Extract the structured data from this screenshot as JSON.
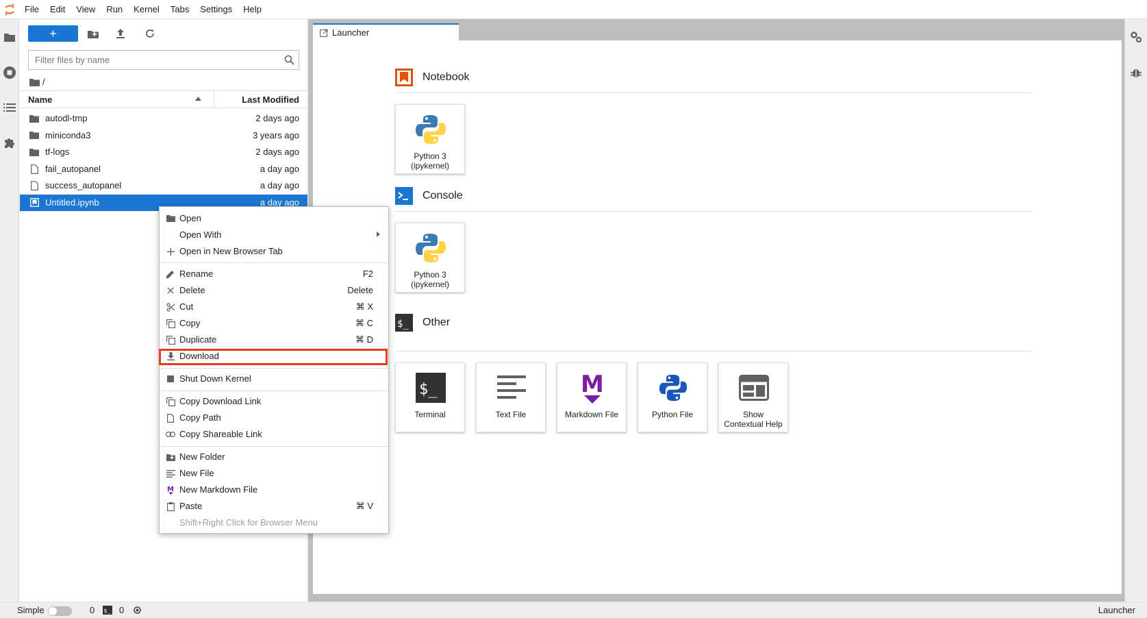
{
  "menubar": {
    "items": [
      "File",
      "Edit",
      "View",
      "Run",
      "Kernel",
      "Tabs",
      "Settings",
      "Help"
    ]
  },
  "file_browser": {
    "new_button_label": "+",
    "search_placeholder": "Filter files by name",
    "breadcrumb": "/",
    "header": {
      "name": "Name",
      "modified": "Last Modified"
    },
    "files": [
      {
        "name": "autodl-tmp",
        "modified": "2 days ago",
        "type": "folder"
      },
      {
        "name": "miniconda3",
        "modified": "3 years ago",
        "type": "folder"
      },
      {
        "name": "tf-logs",
        "modified": "2 days ago",
        "type": "folder"
      },
      {
        "name": "fail_autopanel",
        "modified": "a day ago",
        "type": "file"
      },
      {
        "name": "success_autopanel",
        "modified": "a day ago",
        "type": "file"
      },
      {
        "name": "Untitled.ipynb",
        "modified": "a day ago",
        "type": "notebook",
        "selected": true
      }
    ]
  },
  "tabs": [
    {
      "label": "Launcher",
      "active": true
    }
  ],
  "launcher": {
    "sections": [
      {
        "title": "Notebook",
        "cards": [
          {
            "label": "Python 3\n(ipykernel)"
          }
        ]
      },
      {
        "title": "Console",
        "cards": [
          {
            "label": "Python 3\n(ipykernel)"
          }
        ]
      },
      {
        "title": "Other",
        "cards": [
          {
            "label": "Terminal"
          },
          {
            "label": "Text File"
          },
          {
            "label": "Markdown File"
          },
          {
            "label": "Python File"
          },
          {
            "label": "Show\nContextual Help"
          }
        ]
      }
    ]
  },
  "context_menu": {
    "items": [
      {
        "label": "Open",
        "shortcut": ""
      },
      {
        "label": "Open With",
        "shortcut": ""
      },
      {
        "label": "Open in New Browser Tab",
        "shortcut": ""
      },
      {
        "label": "Rename",
        "shortcut": "F2"
      },
      {
        "label": "Delete",
        "shortcut": "Delete"
      },
      {
        "label": "Cut",
        "shortcut": "⌘ X"
      },
      {
        "label": "Copy",
        "shortcut": "⌘ C"
      },
      {
        "label": "Duplicate",
        "shortcut": "⌘ D"
      },
      {
        "label": "Download",
        "shortcut": "",
        "highlighted": true
      },
      {
        "label": "Shut Down Kernel",
        "shortcut": ""
      },
      {
        "label": "Copy Download Link",
        "shortcut": ""
      },
      {
        "label": "Copy Path",
        "shortcut": ""
      },
      {
        "label": "Copy Shareable Link",
        "shortcut": ""
      },
      {
        "label": "New Folder",
        "shortcut": ""
      },
      {
        "label": "New File",
        "shortcut": ""
      },
      {
        "label": "New Markdown File",
        "shortcut": ""
      },
      {
        "label": "Paste",
        "shortcut": "⌘ V"
      },
      {
        "label": "Shift+Right Click for Browser Menu",
        "shortcut": ""
      }
    ]
  },
  "statusbar": {
    "mode_label": "Simple",
    "kernels_count": "0",
    "terminals_count": "0",
    "right_label": "Launcher"
  },
  "colors": {
    "accent": "#1976d2",
    "highlight_border": "#e53a1e",
    "notebook_orange": "#e65100",
    "console_blue": "#1976d2",
    "markdown_purple": "#7b1fa2"
  }
}
